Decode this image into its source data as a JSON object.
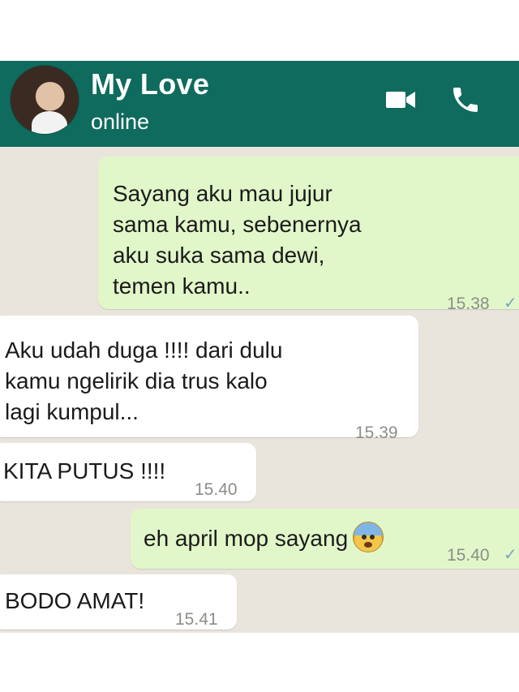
{
  "contact": {
    "name": "My Love",
    "status": "online"
  },
  "header_icons": {
    "video": "video-camera-icon",
    "call": "phone-icon"
  },
  "colors": {
    "header": "#0f6b5e",
    "outgoing_bubble": "#e1f7c9",
    "incoming_bubble": "#ffffff",
    "chat_background": "#e9e5dc",
    "read_tick": "#7aa6bf"
  },
  "messages": [
    {
      "direction": "outgoing",
      "text": "Sayang aku mau jujur\nsama kamu, sebenernya\naku suka sama dewi,\ntemen kamu..",
      "time": "15.38",
      "status": "✓✓"
    },
    {
      "direction": "incoming",
      "text": "Aku udah duga !!!! dari dulu\nkamu ngelirik dia trus kalo\nlagi kumpul...",
      "time": "15.39"
    },
    {
      "direction": "incoming",
      "text": "KITA PUTUS !!!!",
      "time": "15.40"
    },
    {
      "direction": "outgoing",
      "text": "eh april mop sayang",
      "emoji": "anxious-face-with-sweat",
      "time": "15.40",
      "status": "✓✓"
    },
    {
      "direction": "incoming",
      "text": "BODO AMAT!",
      "time": "15.41"
    }
  ]
}
